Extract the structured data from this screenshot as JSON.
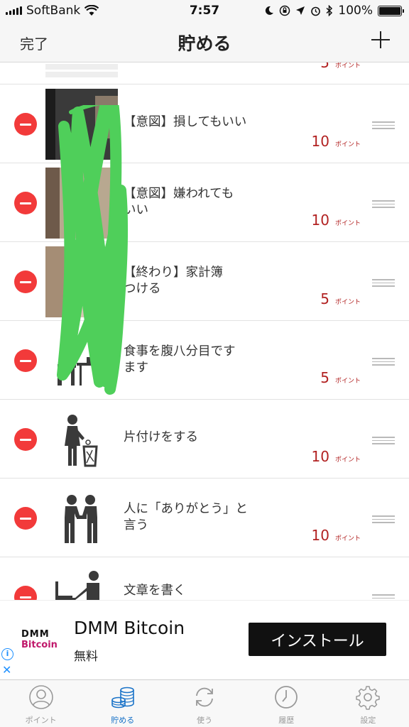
{
  "status_bar": {
    "carrier": "SoftBank",
    "time": "7:57",
    "battery": "100%"
  },
  "nav": {
    "done_label": "完了",
    "title": "貯める"
  },
  "rows": [
    {
      "title": "",
      "points": "5",
      "unit": "ポイント",
      "icon": "photo-thumbnail"
    },
    {
      "title": "【意図】損してもいい",
      "points": "10",
      "unit": "ポイント",
      "icon": "photo-thumbnail"
    },
    {
      "title": "【意図】嫌われても\nいい",
      "points": "10",
      "unit": "ポイント",
      "icon": "photo-thumbnail"
    },
    {
      "title": "【終わり】家計簿\nつける",
      "points": "5",
      "unit": "ポイント",
      "icon": "photo-thumbnail"
    },
    {
      "title": "食事を腹八分目です\nます",
      "points": "5",
      "unit": "ポイント",
      "icon": "person-eating-icon"
    },
    {
      "title": "片付けをする",
      "points": "10",
      "unit": "ポイント",
      "icon": "person-trash-icon"
    },
    {
      "title": "人に「ありがとう」と\n言う",
      "points": "10",
      "unit": "ポイント",
      "icon": "handshake-icon"
    },
    {
      "title": "文章を書く",
      "points": "",
      "unit": "",
      "icon": "person-writing-icon"
    }
  ],
  "ad": {
    "logo_top": "DMM",
    "logo_bottom": "Bitcoin",
    "title": "DMM Bitcoin",
    "subtitle": "無料",
    "install_label": "インストール"
  },
  "tabs": [
    {
      "label": "ポイント",
      "icon": "person-circle-icon",
      "active": false
    },
    {
      "label": "貯める",
      "icon": "coins-icon",
      "active": true
    },
    {
      "label": "使う",
      "icon": "refresh-icon",
      "active": false
    },
    {
      "label": "履歴",
      "icon": "clock-icon",
      "active": false
    },
    {
      "label": "設定",
      "icon": "gear-icon",
      "active": false
    }
  ],
  "colors": {
    "accent": "#1a73c8",
    "points": "#b22222",
    "delete": "#f23a3a",
    "scribble": "#4fcf5a"
  }
}
